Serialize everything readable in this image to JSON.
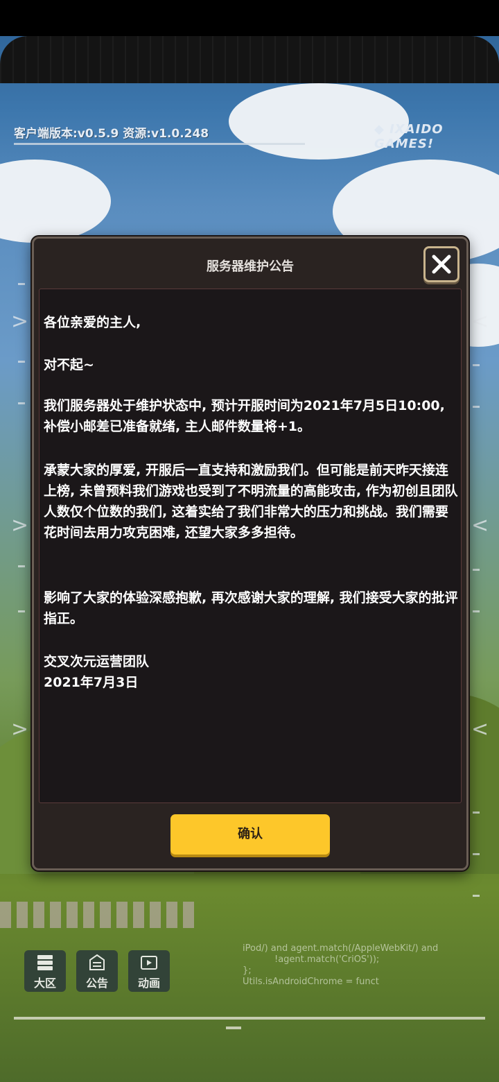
{
  "header": {
    "version_text": "客户端版本:v0.5.9  资源:v1.0.248",
    "brand": "◆ IXAIDO GAMES!"
  },
  "dialog": {
    "title": "服务器维护公告",
    "close_icon": "close-icon",
    "paragraphs": [
      "各位亲爱的主人,",
      "对不起~",
      "我们服务器处于维护状态中, 预计开服时间为2021年7月5日10:00, 补偿小邮差已准备就绪, 主人邮件数量将+1。",
      "承蒙大家的厚爱, 开服后一直支持和激励我们。但可能是前天昨天接连上榜, 未曾预料我们游戏也受到了不明流量的高能攻击, 作为初创且团队人数仅个位数的我们, 这着实给了我们非常大的压力和挑战。我们需要花时间去用力攻克困难, 还望大家多多担待。",
      "影响了大家的体验深感抱歉, 再次感谢大家的理解, 我们接受大家的批评指正。",
      "交叉次元运营团队",
      "2021年7月3日"
    ],
    "confirm_label": "确认"
  },
  "bottom_nav": [
    {
      "label": "大区",
      "icon": "server-icon"
    },
    {
      "label": "公告",
      "icon": "announcement-icon"
    },
    {
      "label": "动画",
      "icon": "video-icon"
    }
  ],
  "debug_code": [
    "iPod/) and agent.match(/AppleWebKit/) and",
    "!agent.match('CriOS'));",
    "};",
    "Utils.isAndroidChrome = funct"
  ],
  "colors": {
    "confirm_button": "#fdc72a",
    "dialog_bg": "#2a2321",
    "content_bg": "#1b1719"
  }
}
